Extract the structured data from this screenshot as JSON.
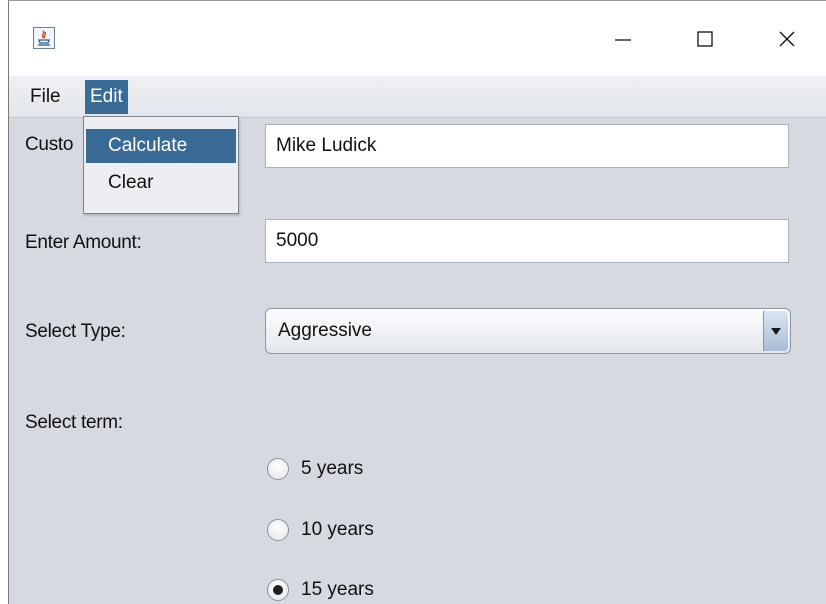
{
  "titlebar": {
    "icon": "java-app-icon",
    "controls": [
      "minimize-icon",
      "maximize-icon",
      "close-icon"
    ]
  },
  "menubar": {
    "file_label": "File",
    "edit_label": "Edit"
  },
  "edit_menu": {
    "items": [
      {
        "label": "Calculate",
        "highlighted": true
      },
      {
        "label": "Clear",
        "highlighted": false
      }
    ]
  },
  "form": {
    "customer_label_visible": "Custo",
    "customer_value": "Mike Ludick",
    "amount_label": "Enter Amount:",
    "amount_value": "5000",
    "type_label": "Select Type:",
    "type_value": "Aggressive",
    "term_label": "Select term:",
    "terms": [
      {
        "label": "5 years",
        "selected": false
      },
      {
        "label": "10 years",
        "selected": false
      },
      {
        "label": "15 years",
        "selected": true
      }
    ]
  },
  "colors": {
    "selection": "#3a6a96",
    "window_bg": "#d6d9df",
    "menubar_bg": "#e8eaee"
  }
}
